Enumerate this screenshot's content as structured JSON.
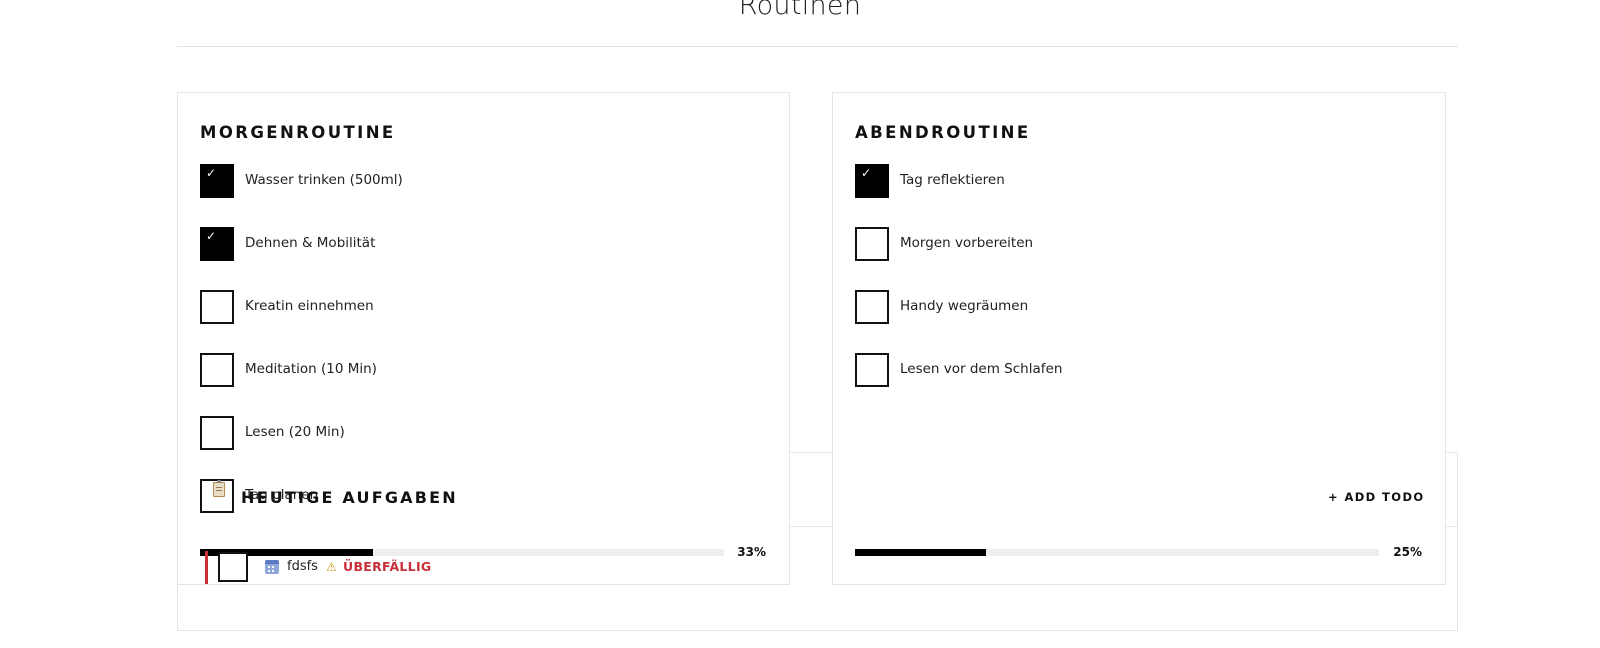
{
  "page": {
    "title": "Routinen"
  },
  "tasks": {
    "title": "HEUTIGE AUFGABEN",
    "add_label": "+ ADD TODO",
    "items": [
      {
        "name": "fdsfs",
        "status": "ÜBERFÄLLIG",
        "checked": false,
        "icon": "calendar-icon"
      }
    ],
    "accent_color": "#c92f38"
  },
  "morning": {
    "title": "MORGENROUTINE",
    "items": [
      {
        "label": "Wasser trinken (500ml)",
        "checked": true
      },
      {
        "label": "Dehnen & Mobilität",
        "checked": true
      },
      {
        "label": "Kreatin einnehmen",
        "checked": false
      },
      {
        "label": "Meditation (10 Min)",
        "checked": false
      },
      {
        "label": "Lesen (20 Min)",
        "checked": false
      },
      {
        "label": "Tag planen",
        "checked": false,
        "icon": "clipboard-icon"
      }
    ],
    "progress": 0.33,
    "progress_label": "33%"
  },
  "evening": {
    "title": "ABENDROUTINE",
    "items": [
      {
        "label": "Tag reflektieren",
        "checked": true
      },
      {
        "label": "Morgen vorbereiten",
        "checked": false
      },
      {
        "label": "Handy wegräumen",
        "checked": false
      },
      {
        "label": "Lesen vor dem Schlafen",
        "checked": false
      }
    ],
    "progress": 0.25,
    "progress_label": "25%"
  },
  "check_mark": "✓"
}
